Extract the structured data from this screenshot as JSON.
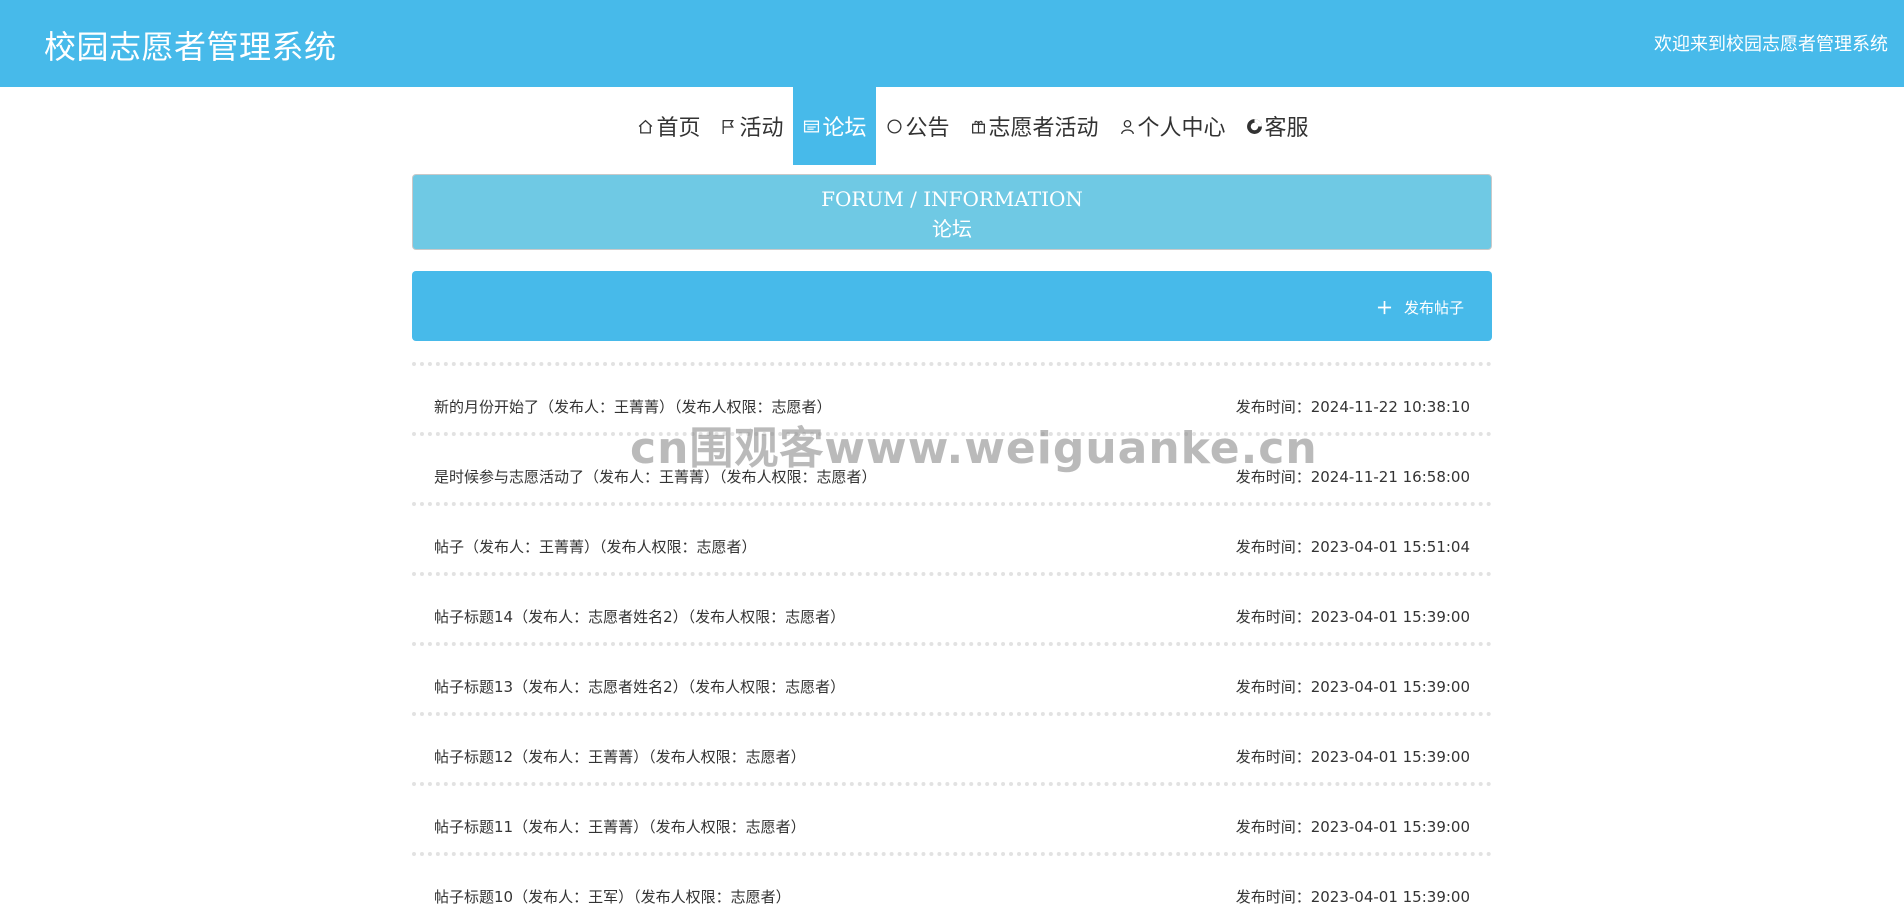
{
  "header": {
    "brand": "校园志愿者管理系统",
    "welcome": "欢迎来到校园志愿者管理系统"
  },
  "nav": [
    {
      "label": "首页",
      "icon": "home-icon"
    },
    {
      "label": "活动",
      "icon": "flag-icon"
    },
    {
      "label": "论坛",
      "icon": "forum-icon"
    },
    {
      "label": "公告",
      "icon": "bell-icon"
    },
    {
      "label": "志愿者活动",
      "icon": "gift-icon"
    },
    {
      "label": "个人中心",
      "icon": "user-icon"
    },
    {
      "label": "客服",
      "icon": "service-icon"
    }
  ],
  "nav_active": "论坛",
  "banner": {
    "en": "FORUM / INFORMATION",
    "cn": "论坛"
  },
  "actions": {
    "post_label": "发布帖子"
  },
  "posts": [
    {
      "title": "新的月份开始了（发布人：王菁菁）（发布人权限：志愿者）",
      "time": "发布时间：2024-11-22 10:38:10"
    },
    {
      "title": "是时候参与志愿活动了（发布人：王菁菁）（发布人权限：志愿者）",
      "time": "发布时间：2024-11-21 16:58:00"
    },
    {
      "title": "帖子（发布人：王菁菁）（发布人权限：志愿者）",
      "time": "发布时间：2023-04-01 15:51:04"
    },
    {
      "title": "帖子标题14（发布人：志愿者姓名2）（发布人权限：志愿者）",
      "time": "发布时间：2023-04-01 15:39:00"
    },
    {
      "title": "帖子标题13（发布人：志愿者姓名2）（发布人权限：志愿者）",
      "time": "发布时间：2023-04-01 15:39:00"
    },
    {
      "title": "帖子标题12（发布人：王菁菁）（发布人权限：志愿者）",
      "time": "发布时间：2023-04-01 15:39:00"
    },
    {
      "title": "帖子标题11（发布人：王菁菁）（发布人权限：志愿者）",
      "time": "发布时间：2023-04-01 15:39:00"
    },
    {
      "title": "帖子标题10（发布人：王军）（发布人权限：志愿者）",
      "time": "发布时间：2023-04-01 15:39:00"
    }
  ],
  "watermark": "cn围观客www.weiguanke.cn",
  "colors": {
    "primary": "#47baea",
    "banner": "#6fc9e4",
    "text": "#333333"
  }
}
